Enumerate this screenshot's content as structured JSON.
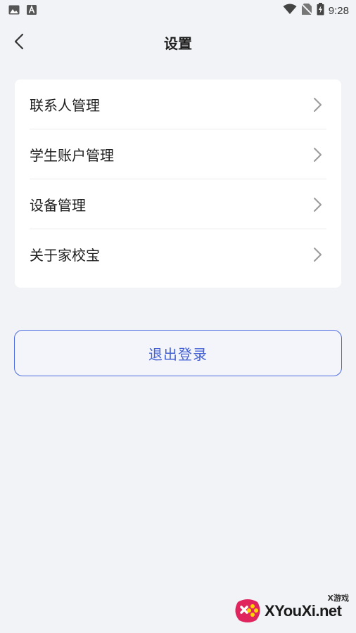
{
  "status_bar": {
    "time": "9:28",
    "left_icons": [
      "image-icon",
      "text-a-icon"
    ],
    "right_icons": [
      "wifi-icon",
      "no-sim-icon",
      "battery-charging-icon"
    ]
  },
  "header": {
    "title": "设置",
    "back_icon": "chevron-left-icon"
  },
  "settings": {
    "items": [
      {
        "label": "联系人管理"
      },
      {
        "label": "学生账户管理"
      },
      {
        "label": "设备管理"
      },
      {
        "label": "关于家校宝"
      }
    ]
  },
  "logout": {
    "label": "退出登录"
  },
  "watermark": {
    "text": "XYouXi.net",
    "sub": "X游戏"
  },
  "colors": {
    "background": "#f2f3f7",
    "card": "#ffffff",
    "accent": "#4462d6",
    "text": "#1e1e1e",
    "chevron": "#9a9a9a"
  }
}
